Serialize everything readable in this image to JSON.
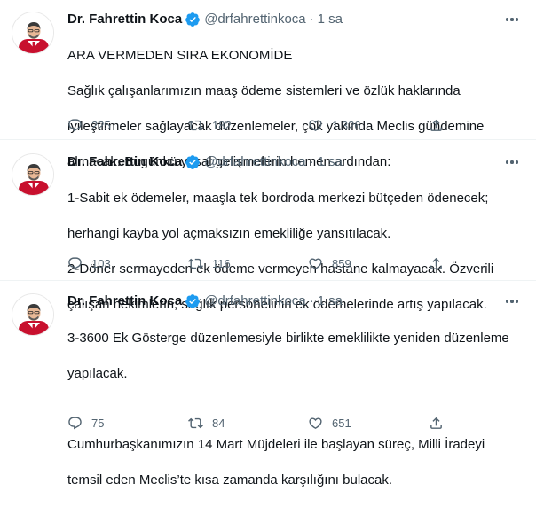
{
  "author": {
    "name": "Dr. Fahrettin Koca",
    "handle": "@drfahrettinkoca",
    "separator": "·",
    "avatar_icon": "person-avatar-icon",
    "verified_icon": "verified-badge-icon"
  },
  "colors": {
    "verified": "#1d9bf0",
    "secondary_text": "#536471",
    "primary_text": "#0f1419",
    "divider": "#eff3f4"
  },
  "tweets": [
    {
      "time": "1 sa",
      "lines": [
        "ARA VERMEDEN SIRA EKONOMİDE",
        "Sağlık çalışanlarımızın maaş ödeme sistemleri ve özlük haklarında",
        "iyileştirmeler sağlayacak düzenlemeler, çok yakında Meclis gündemine",
        "alınacak. Bugünkü yasal gelişmelerin hemen ardından:"
      ],
      "replies": "225",
      "retweets": "182",
      "likes": "1.326"
    },
    {
      "time": "1 sa",
      "lines": [
        "1-Sabit ek ödemeler, maaşla tek bordroda merkezi bütçeden ödenecek;",
        "herhangi kayba yol açmaksızın emekliliğe yansıtılacak.",
        "2-Döner sermayeden ek ödeme vermeyen hastane kalmayacak. Özverili",
        "çalışan hekimlerin, sağlık personelinin ek ödemelerinde artış yapılacak."
      ],
      "replies": "103",
      "retweets": "116",
      "likes": "859"
    },
    {
      "time": "1 sa",
      "lines": [
        "3-3600 Ek Gösterge düzenlemesiyle birlikte emeklilikte yeniden düzenleme",
        "yapılacak.",
        "",
        "Cumhurbaşkanımızın 14 Mart Müjdeleri ile başlayan süreç, Milli İradeyi",
        "temsil eden Meclis’te kısa zamanda karşılığını bulacak."
      ],
      "replies": "75",
      "retweets": "84",
      "likes": "651"
    }
  ]
}
